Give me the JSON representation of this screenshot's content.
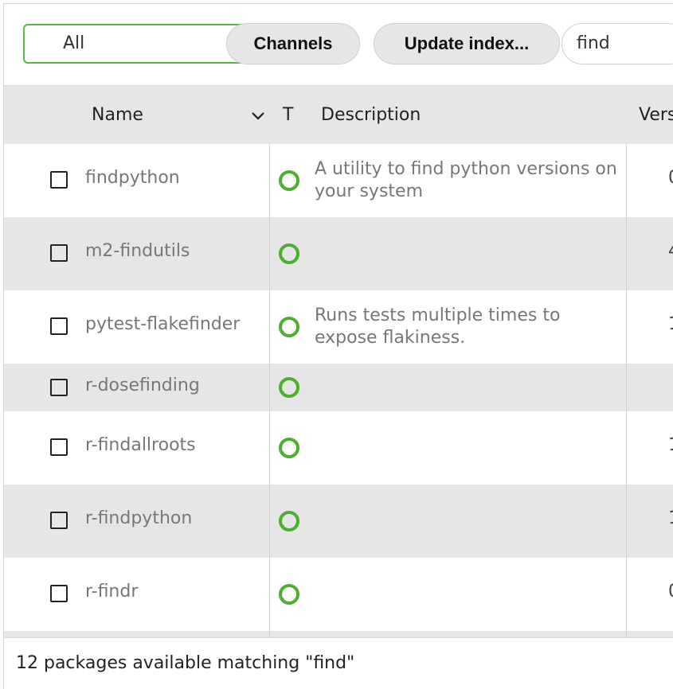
{
  "toolbar": {
    "filter_select": "All",
    "channels_label": "Channels",
    "update_label": "Update index...",
    "search_value": "find"
  },
  "table": {
    "columns": {
      "name": "Name",
      "type": "T",
      "description": "Description",
      "version": "Vers"
    },
    "rows": [
      {
        "name": "findpython",
        "description": "A utility to find python versions on your system",
        "version": "0"
      },
      {
        "name": "m2-findutils",
        "description": "",
        "version": "4"
      },
      {
        "name": "pytest-flakefinder",
        "description": "Runs tests multiple times to expose flakiness.",
        "version": "1"
      },
      {
        "name": "r-dosefinding",
        "description": "",
        "version": ""
      },
      {
        "name": "r-findallroots",
        "description": "",
        "version": "1"
      },
      {
        "name": "r-findpython",
        "description": "",
        "version": "1"
      },
      {
        "name": "r-findr",
        "description": "",
        "version": "0"
      }
    ]
  },
  "footer": {
    "status": "12 packages available matching \"find\""
  },
  "icons": {
    "status": "conda-circle-icon",
    "sort": "chevron-down-icon"
  },
  "colors": {
    "accent": "#5fb44a",
    "row_alt": "#e6e6e6"
  }
}
